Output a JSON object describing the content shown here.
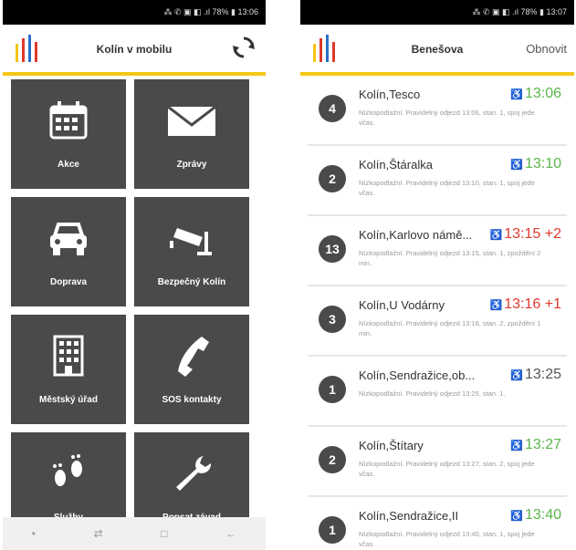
{
  "left": {
    "status": "⁂ ✆ ▣ ◧ .ıl 78% ▮ 13:06",
    "title": "Kolín v mobilu",
    "tiles": [
      {
        "label": "Akce",
        "icon": "calendar-icon"
      },
      {
        "label": "Zprávy",
        "icon": "envelope-icon"
      },
      {
        "label": "Doprava",
        "icon": "car-icon"
      },
      {
        "label": "Bezpečný Kolín",
        "icon": "camera-icon"
      },
      {
        "label": "Městský úřad",
        "icon": "building-icon"
      },
      {
        "label": "SOS kontakty",
        "icon": "phone-icon"
      },
      {
        "label": "Služby",
        "icon": "footprints-icon"
      },
      {
        "label": "Popsat závad",
        "icon": "wrench-icon"
      }
    ],
    "nav": [
      "•",
      "⇄",
      "□",
      "←"
    ]
  },
  "right": {
    "status": "⁂ ✆ ▣ ◧ .ıl 78% ▮ 13:07",
    "title": "Benešova",
    "refresh_label": "Obnovit",
    "departures": [
      {
        "line": "4",
        "stop": "Kolín,Tesco",
        "time": "13:06",
        "status": "green",
        "desc": "Nízkopodlažní. Pravidelný odjezd 13:06, stan. 1, spoj jede včas."
      },
      {
        "line": "2",
        "stop": "Kolín,Štáralka",
        "time": "13:10",
        "status": "green",
        "desc": "Nízkopodlažní. Pravidelný odjezd 13:10, stan. 1, spoj jede včas."
      },
      {
        "line": "13",
        "stop": "Kolín,Karlovo námě...",
        "time": "13:15 +2",
        "status": "red",
        "desc": "Nízkopodlažní. Pravidelný odjezd 13:15, stan. 1, zpoždění 2 min."
      },
      {
        "line": "3",
        "stop": "Kolín,U Vodárny",
        "time": "13:16 +1",
        "status": "red",
        "desc": "Nízkopodlažní. Pravidelný odjezd 13:16, stan. 2, zpoždění 1 min."
      },
      {
        "line": "1",
        "stop": "Kolín,Sendražice,ob...",
        "time": "13:25",
        "status": "grey",
        "desc": "Nízkopodlažní. Pravidelný odjezd 13:25, stan. 1."
      },
      {
        "line": "2",
        "stop": "Kolín,Štítary",
        "time": "13:27",
        "status": "green",
        "desc": "Nízkopodlažní. Pravidelný odjezd 13:27, stan. 2, spoj jede včas."
      },
      {
        "line": "1",
        "stop": "Kolín,Sendražice,II",
        "time": "13:40",
        "status": "green",
        "desc": "Nízkopodlažní. Pravidelný odjezd 13:40, stan. 1, spoj jede včas."
      }
    ],
    "accessibility_icon": "wheelchair-icon"
  },
  "colors": {
    "accent": "#f5c518",
    "tile": "#4a4a4a",
    "on_time": "#5ab64a",
    "delayed": "#e0392b"
  }
}
